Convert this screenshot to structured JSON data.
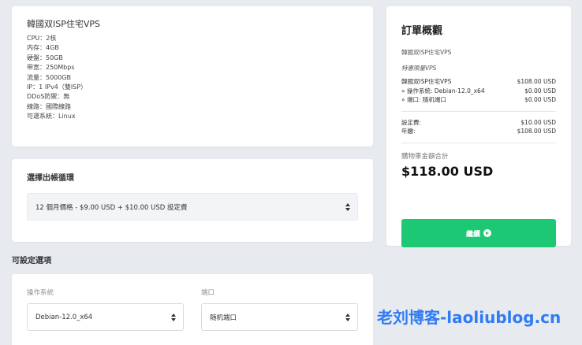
{
  "product": {
    "title": "韓國双ISP住宅VPS",
    "specs": [
      "CPU：2核",
      "内存：4GB",
      "硬盤：50GB",
      "带宽：250Mbps",
      "流量：5000GB",
      "IP：1 IPv4（雙ISP）",
      "DDoS防禦：無",
      "線路：國際線路",
      "可選系統：Linux"
    ]
  },
  "billing": {
    "heading": "選擇出帳循環",
    "selected": "12 個月價格 - $9.00 USD + $10.00 USD 設定費"
  },
  "config": {
    "heading": "可設定選項",
    "os_label": "操作系統",
    "os_value": "Debian-12.0_x64",
    "port_label": "端口",
    "port_value": "随机端口"
  },
  "summary": {
    "title": "訂單概觀",
    "product_name": "韓國双ISP住宅VPS",
    "group_name": "特惠限量VPS",
    "line_item": {
      "label": "韓國双ISP住宅VPS",
      "price": "$108.00 USD"
    },
    "options": [
      {
        "label": "» 操作系統: Debian-12.0_x64",
        "price": "$0.00 USD"
      },
      {
        "label": "» 端口: 随机端口",
        "price": "$0.00 USD"
      }
    ],
    "setup_fee": {
      "label": "設定費:",
      "price": "$10.00 USD"
    },
    "annual": {
      "label": "年繳:",
      "price": "$108.00 USD"
    },
    "total_label": "購物車金額合計",
    "total_amount": "$118.00 USD",
    "continue_label": "繼續",
    "accent_color": "#1dc875"
  },
  "watermark": "老刘博客-laoliublog.cn"
}
